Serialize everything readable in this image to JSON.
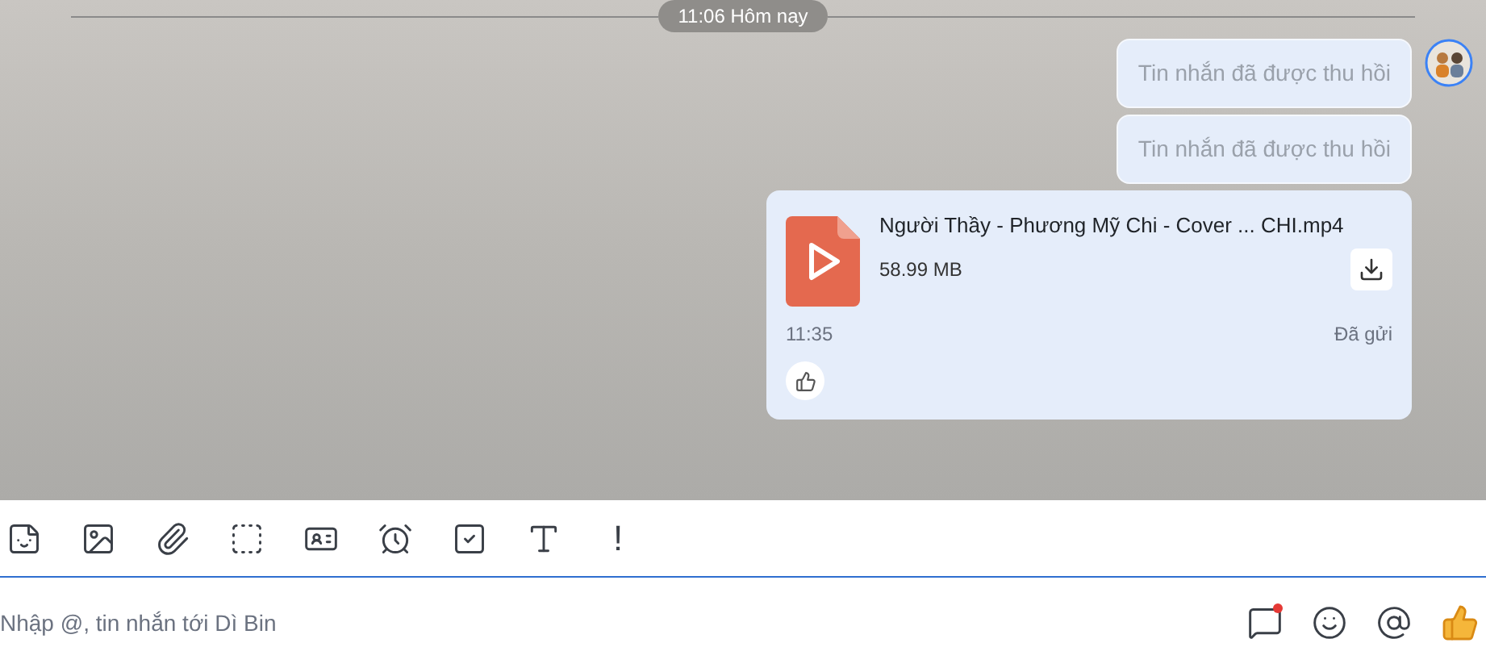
{
  "date_separator": "11:06 Hôm nay",
  "messages": [
    {
      "kind": "recalled",
      "text": "Tin nhắn đã được thu hồi",
      "avatar": true
    },
    {
      "kind": "recalled",
      "text": "Tin nhắn đã được thu hồi",
      "avatar": false
    },
    {
      "kind": "file",
      "file_name": "Người Thầy - Phương Mỹ Chi - Cover ... CHI.mp4",
      "file_size": "58.99 MB",
      "time": "11:35",
      "status": "Đã gửi",
      "avatar": false
    }
  ],
  "toolbar_exclaim": "!",
  "composer": {
    "placeholder": "Nhập @, tin nhắn tới Dì Bin",
    "notification_dot": true
  }
}
